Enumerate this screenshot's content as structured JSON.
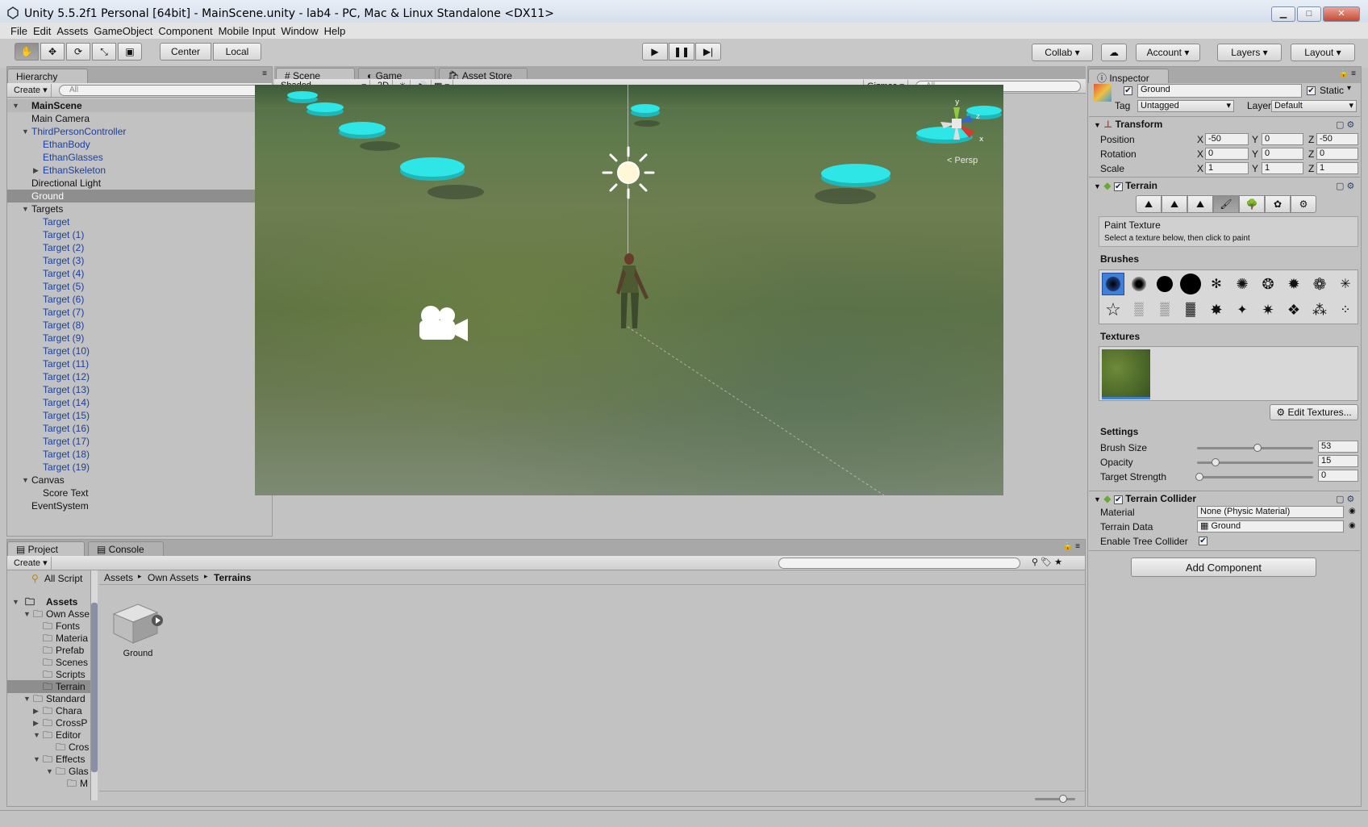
{
  "window": {
    "title": "Unity 5.5.2f1 Personal [64bit] - MainScene.unity - lab4 - PC, Mac & Linux Standalone <DX11>"
  },
  "menu": [
    "File",
    "Edit",
    "Assets",
    "GameObject",
    "Component",
    "Mobile Input",
    "Window",
    "Help"
  ],
  "toolbar": {
    "center": "Center",
    "local": "Local",
    "collab": "Collab",
    "account": "Account",
    "layers": "Layers",
    "layout": "Layout"
  },
  "hierarchy": {
    "tab": "Hierarchy",
    "create": "Create",
    "search": "All",
    "scene": "MainScene",
    "items": [
      "Main Camera",
      "ThirdPersonController",
      "EthanBody",
      "EthanGlasses",
      "EthanSkeleton",
      "Directional Light",
      "Ground",
      "Targets",
      "Target",
      "Target (1)",
      "Target (2)",
      "Target (3)",
      "Target (4)",
      "Target (5)",
      "Target (6)",
      "Target (7)",
      "Target (8)",
      "Target (9)",
      "Target (10)",
      "Target (11)",
      "Target (12)",
      "Target (13)",
      "Target (14)",
      "Target (15)",
      "Target (16)",
      "Target (17)",
      "Target (18)",
      "Target (19)",
      "Canvas",
      "Score Text",
      "EventSystem"
    ]
  },
  "scene_tabs": {
    "scene": "Scene",
    "game": "Game",
    "store": "Asset Store",
    "shaded": "Shaded",
    "twod": "2D",
    "gizmos": "Gizmos",
    "search": "All",
    "persp": "< Persp"
  },
  "inspector": {
    "tab": "Inspector",
    "name": "Ground",
    "static": "Static",
    "tag_label": "Tag",
    "tag": "Untagged",
    "layer_label": "Layer",
    "layer": "Default",
    "transform": "Transform",
    "position": "Position",
    "rotation": "Rotation",
    "scale": "Scale",
    "pos": [
      "-50",
      "0",
      "-50"
    ],
    "rot": [
      "0",
      "0",
      "0"
    ],
    "scl": [
      "1",
      "1",
      "1"
    ],
    "terrain": "Terrain",
    "paint_title": "Paint Texture",
    "paint_hint": "Select a texture below, then click to paint",
    "brushes": "Brushes",
    "textures": "Textures",
    "edit_textures": "Edit Textures...",
    "settings": "Settings",
    "brush_size": "Brush Size",
    "brush_size_v": "53",
    "opacity": "Opacity",
    "opacity_v": "15",
    "target_strength": "Target Strength",
    "target_strength_v": "0",
    "collider": "Terrain Collider",
    "material": "Material",
    "material_v": "None (Physic Material)",
    "terrain_data": "Terrain Data",
    "terrain_data_v": "Ground",
    "tree_collider": "Enable Tree Collider",
    "add_component": "Add Component"
  },
  "project": {
    "tab": "Project",
    "console": "Console",
    "create": "Create",
    "all_scripts": "All Script",
    "crumbs": [
      "Assets",
      "Own Assets",
      "Terrains"
    ],
    "asset": "Ground",
    "tree": [
      "Assets",
      "Own Asse",
      "Fonts",
      "Materia",
      "Prefab",
      "Scenes",
      "Scripts",
      "Terrain",
      "Standard",
      "Chara",
      "CrossP",
      "Editor",
      "Cros",
      "Effects",
      "Glas",
      "M"
    ]
  },
  "colors": {
    "target": "#2ee6e6",
    "panel": "#c2c2c2",
    "hier_link": "#1a3f9e"
  }
}
